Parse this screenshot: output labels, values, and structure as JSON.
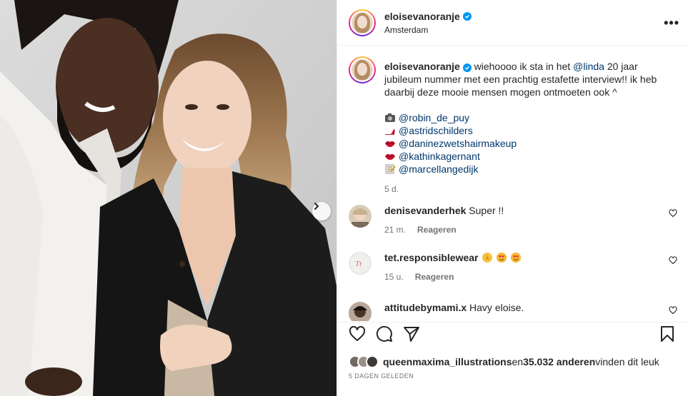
{
  "post": {
    "username": "eloisevanoranje",
    "location": "Amsterdam",
    "more_icon": "more-horizontal-icon"
  },
  "caption": {
    "username": "eloisevanoranje",
    "text_before": " wiehoooo ik sta in het ",
    "mention": "@linda",
    "text_after": " 20 jaar jubileum nummer met een prachtig estafette interview!! ik heb daarbij deze mooie mensen mogen ontmoeten ook ^",
    "tags": [
      {
        "icon": "camera-emoji",
        "handle": "@robin_de_puy"
      },
      {
        "icon": "high-heel-emoji",
        "handle": "@astridschilders"
      },
      {
        "icon": "lips-emoji",
        "handle": "@daninezwetshairmakeup"
      },
      {
        "icon": "lips-emoji",
        "handle": "@kathinkagernant"
      },
      {
        "icon": "memo-emoji",
        "handle": "@marcellangedijk"
      }
    ],
    "time": "5 d."
  },
  "comments": [
    {
      "username": "denisevanderhek",
      "text": "Super !!",
      "time": "21 m.",
      "reply": "Reageren"
    },
    {
      "username": "tet.responsiblewear",
      "text": "",
      "emojis": [
        "clap-emoji",
        "heart-eyes-emoji",
        "heart-eyes-emoji"
      ],
      "time": "15 u.",
      "reply": "Reageren"
    },
    {
      "username": "attitudebymami.x",
      "text": "Havy eloise."
    }
  ],
  "likes": {
    "user": "queenmaxima_illustrations",
    "middle": " en ",
    "count": "35.032 anderen",
    "suffix": " vinden dit leuk"
  },
  "date": "5 DAGEN GELEDEN",
  "colors": {
    "accent": "#0095f6",
    "mention": "#00376b",
    "muted": "#737373"
  }
}
